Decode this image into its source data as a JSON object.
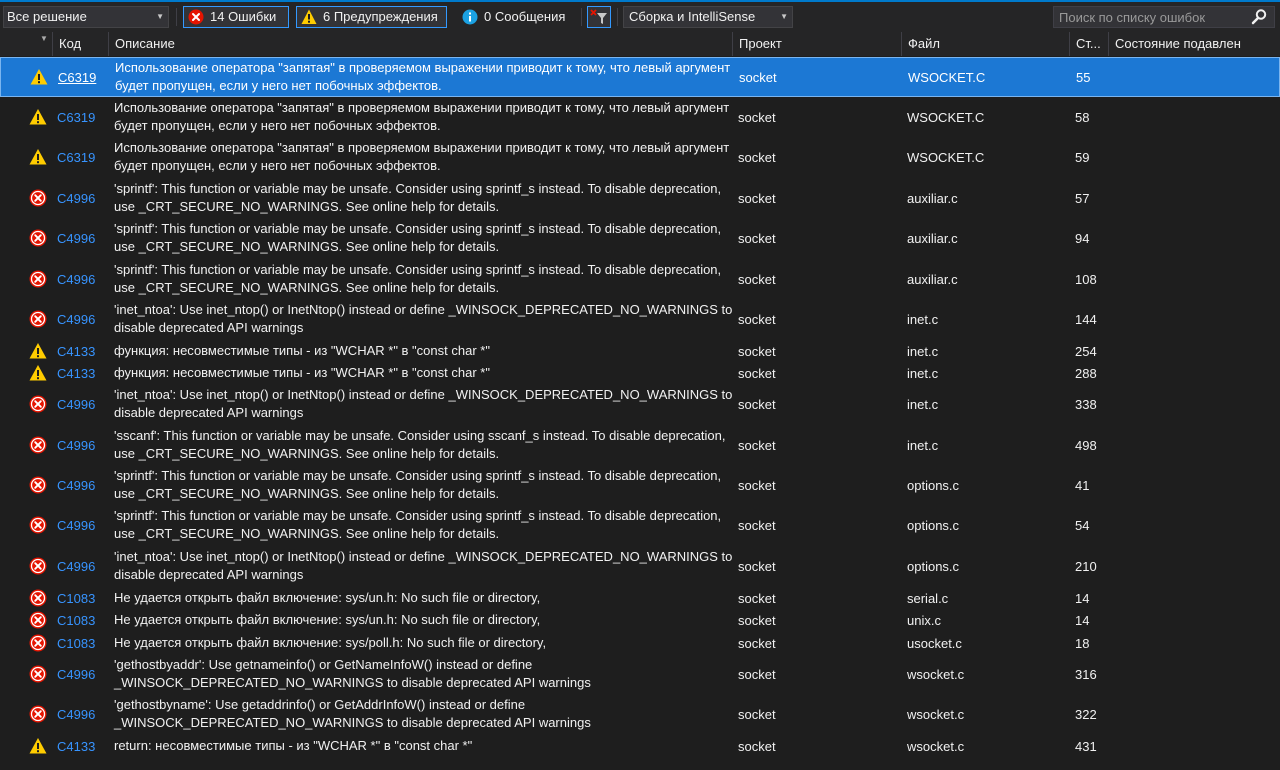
{
  "toolbar": {
    "scope": "Все решение",
    "errors_label": "14 Ошибки",
    "warnings_label": "6 Предупреждения",
    "messages_label": "0 Сообщения",
    "build_filter": "Сборка и IntelliSense",
    "search_placeholder": "Поиск по списку ошибок"
  },
  "columns": {
    "code": "Код",
    "description": "Описание",
    "project": "Проект",
    "file": "Файл",
    "line": "Ст...",
    "suppression": "Состояние подавлен"
  },
  "colors": {
    "accent": "#007acc",
    "selected_row": "#1c78d4",
    "link": "#3794ff",
    "error_icon": "#e51400",
    "warning_icon": "#ffcc00",
    "info_icon": "#1ba1e2"
  },
  "rows": [
    {
      "severity": "warning",
      "code": "C6319",
      "description": "Использование оператора \"запятая\" в проверяемом выражении приводит к тому, что левый аргумент будет пропущен, если у него нет побочных эффектов.",
      "project": "socket",
      "file": "WSOCKET.C",
      "line": "55",
      "selected": true
    },
    {
      "severity": "warning",
      "code": "C6319",
      "description": "Использование оператора \"запятая\" в проверяемом выражении приводит к тому, что левый аргумент будет пропущен, если у него нет побочных эффектов.",
      "project": "socket",
      "file": "WSOCKET.C",
      "line": "58"
    },
    {
      "severity": "warning",
      "code": "C6319",
      "description": "Использование оператора \"запятая\" в проверяемом выражении приводит к тому, что левый аргумент будет пропущен, если у него нет побочных эффектов.",
      "project": "socket",
      "file": "WSOCKET.C",
      "line": "59"
    },
    {
      "severity": "error",
      "code": "C4996",
      "description": "'sprintf': This function or variable may be unsafe. Consider using sprintf_s instead. To disable deprecation, use _CRT_SECURE_NO_WARNINGS. See online help for details.",
      "project": "socket",
      "file": "auxiliar.c",
      "line": "57"
    },
    {
      "severity": "error",
      "code": "C4996",
      "description": "'sprintf': This function or variable may be unsafe. Consider using sprintf_s instead. To disable deprecation, use _CRT_SECURE_NO_WARNINGS. See online help for details.",
      "project": "socket",
      "file": "auxiliar.c",
      "line": "94"
    },
    {
      "severity": "error",
      "code": "C4996",
      "description": "'sprintf': This function or variable may be unsafe. Consider using sprintf_s instead. To disable deprecation, use _CRT_SECURE_NO_WARNINGS. See online help for details.",
      "project": "socket",
      "file": "auxiliar.c",
      "line": "108"
    },
    {
      "severity": "error",
      "code": "C4996",
      "description": "'inet_ntoa': Use inet_ntop() or InetNtop() instead or define _WINSOCK_DEPRECATED_NO_WARNINGS to disable deprecated API warnings",
      "project": "socket",
      "file": "inet.c",
      "line": "144"
    },
    {
      "severity": "warning",
      "code": "C4133",
      "description": "функция: несовместимые типы - из \"WCHAR *\" в \"const char *\"",
      "project": "socket",
      "file": "inet.c",
      "line": "254"
    },
    {
      "severity": "warning",
      "code": "C4133",
      "description": "функция: несовместимые типы - из \"WCHAR *\" в \"const char *\"",
      "project": "socket",
      "file": "inet.c",
      "line": "288"
    },
    {
      "severity": "error",
      "code": "C4996",
      "description": "'inet_ntoa': Use inet_ntop() or InetNtop() instead or define _WINSOCK_DEPRECATED_NO_WARNINGS to disable deprecated API warnings",
      "project": "socket",
      "file": "inet.c",
      "line": "338"
    },
    {
      "severity": "error",
      "code": "C4996",
      "description": "'sscanf': This function or variable may be unsafe. Consider using sscanf_s instead. To disable deprecation, use _CRT_SECURE_NO_WARNINGS. See online help for details.",
      "project": "socket",
      "file": "inet.c",
      "line": "498"
    },
    {
      "severity": "error",
      "code": "C4996",
      "description": "'sprintf': This function or variable may be unsafe. Consider using sprintf_s instead. To disable deprecation, use _CRT_SECURE_NO_WARNINGS. See online help for details.",
      "project": "socket",
      "file": "options.c",
      "line": "41"
    },
    {
      "severity": "error",
      "code": "C4996",
      "description": "'sprintf': This function or variable may be unsafe. Consider using sprintf_s instead. To disable deprecation, use _CRT_SECURE_NO_WARNINGS. See online help for details.",
      "project": "socket",
      "file": "options.c",
      "line": "54"
    },
    {
      "severity": "error",
      "code": "C4996",
      "description": "'inet_ntoa': Use inet_ntop() or InetNtop() instead or define _WINSOCK_DEPRECATED_NO_WARNINGS to disable deprecated API warnings",
      "project": "socket",
      "file": "options.c",
      "line": "210"
    },
    {
      "severity": "error",
      "code": "C1083",
      "description": "Не удается открыть файл включение: sys/un.h: No such file or directory,",
      "project": "socket",
      "file": "serial.c",
      "line": "14"
    },
    {
      "severity": "error",
      "code": "C1083",
      "description": "Не удается открыть файл включение: sys/un.h: No such file or directory,",
      "project": "socket",
      "file": "unix.c",
      "line": "14"
    },
    {
      "severity": "error",
      "code": "C1083",
      "description": "Не удается открыть файл включение: sys/poll.h: No such file or directory,",
      "project": "socket",
      "file": "usocket.c",
      "line": "18"
    },
    {
      "severity": "error",
      "code": "C4996",
      "description": "'gethostbyaddr': Use getnameinfo() or GetNameInfoW() instead or define _WINSOCK_DEPRECATED_NO_WARNINGS to disable deprecated API warnings",
      "project": "socket",
      "file": "wsocket.c",
      "line": "316"
    },
    {
      "severity": "error",
      "code": "C4996",
      "description": "'gethostbyname': Use getaddrinfo() or GetAddrInfoW() instead or define _WINSOCK_DEPRECATED_NO_WARNINGS to disable deprecated API warnings",
      "project": "socket",
      "file": "wsocket.c",
      "line": "322"
    },
    {
      "severity": "warning",
      "code": "C4133",
      "description": "return: несовместимые типы - из \"WCHAR *\" в \"const char *\"",
      "project": "socket",
      "file": "wsocket.c",
      "line": "431"
    }
  ]
}
